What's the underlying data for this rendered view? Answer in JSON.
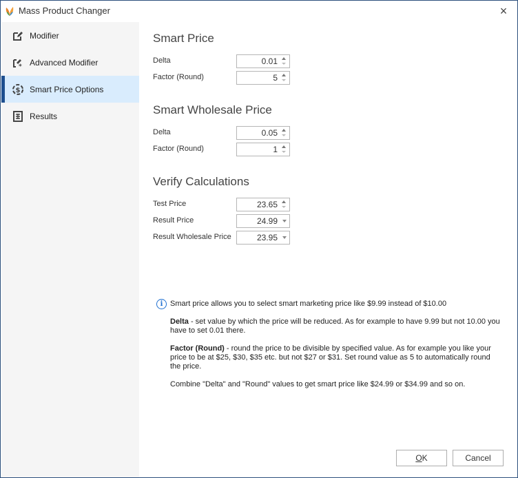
{
  "window": {
    "title": "Mass Product Changer",
    "close_label": "×",
    "border_color": "#2b4f7c",
    "accent_color": "#1e4f8f"
  },
  "sidebar": {
    "items": [
      {
        "label": "Modifier",
        "icon": "edit-icon",
        "active": false
      },
      {
        "label": "Advanced Modifier",
        "icon": "advanced-edit-icon",
        "active": false
      },
      {
        "label": "Smart Price Options",
        "icon": "smart-price-icon",
        "active": true
      },
      {
        "label": "Results",
        "icon": "results-grid-icon",
        "active": false
      }
    ]
  },
  "smart_price": {
    "title": "Smart Price",
    "delta_label": "Delta",
    "delta_value": "0.01",
    "factor_label": "Factor (Round)",
    "factor_value": "5"
  },
  "smart_wholesale_price": {
    "title": "Smart Wholesale Price",
    "delta_label": "Delta",
    "delta_value": "0.05",
    "factor_label": "Factor (Round)",
    "factor_value": "1"
  },
  "verify": {
    "title": "Verify Calculations",
    "test_price_label": "Test Price",
    "test_price_value": "23.65",
    "result_price_label": "Result Price",
    "result_price_value": "24.99",
    "result_wholesale_label": "Result Wholesale Price",
    "result_wholesale_value": "23.95"
  },
  "info": {
    "headline": "Smart price allows you to select smart marketing price like $9.99 instead of $10.00",
    "delta_term": "Delta",
    "delta_text": " - set value by which the price will be reduced. As for example to have 9.99 but not 10.00 you have to set 0.01 there.",
    "factor_term": "Factor (Round)",
    "factor_text": " - round the price to be divisible by specified value. As for example you like your price to be at $25, $30, $35 etc. but not $27 or $31. Set round value as 5 to automatically round the price.",
    "combine_text": "Combine \"Delta\" and \"Round\" values to get smart price like $24.99 or $34.99 and so on."
  },
  "buttons": {
    "ok_mnemonic": "O",
    "ok_rest": "K",
    "cancel_label": "Cancel"
  }
}
